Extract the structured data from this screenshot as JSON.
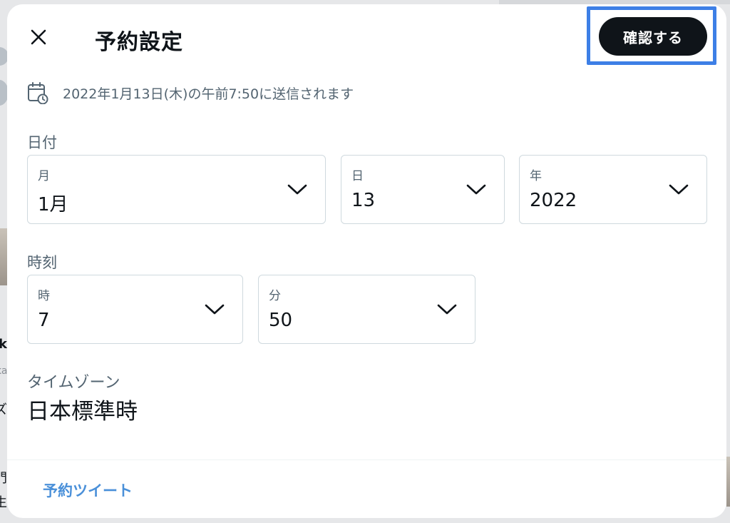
{
  "background": {
    "fragments": [
      "k",
      "ka",
      "ズ",
      "門",
      "生"
    ]
  },
  "modal": {
    "title": "予約設定",
    "confirm_label": "確認する",
    "schedule_summary": "2022年1月13日(木)の午前7:50に送信されます",
    "date_section": {
      "label": "日付",
      "month": {
        "caption": "月",
        "value": "1月"
      },
      "day": {
        "caption": "日",
        "value": "13"
      },
      "year": {
        "caption": "年",
        "value": "2022"
      }
    },
    "time_section": {
      "label": "時刻",
      "hour": {
        "caption": "時",
        "value": "7"
      },
      "minute": {
        "caption": "分",
        "value": "50"
      }
    },
    "timezone": {
      "label": "タイムゾーン",
      "value": "日本標準時"
    },
    "footer_link": "予約ツイート"
  },
  "icons": {
    "close": "close-icon",
    "calendar": "calendar-clock-icon",
    "chevron": "chevron-down-icon"
  },
  "colors": {
    "primary_text": "#0f1419",
    "secondary_text": "#536471",
    "link": "#4a90d9",
    "highlight": "#3d7fe6",
    "button_bg": "#0f1419"
  }
}
